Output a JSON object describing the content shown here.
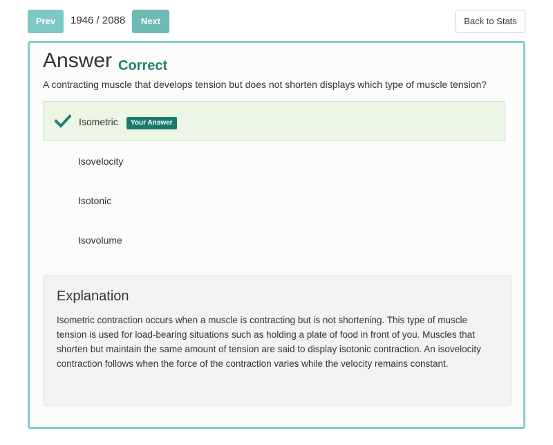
{
  "nav": {
    "prev_label": "Prev",
    "next_label": "Next",
    "counter": "1946 / 2088",
    "back_label": "Back to Stats"
  },
  "answer": {
    "heading": "Answer",
    "status": "Correct",
    "question": "A contracting muscle that develops tension but does not shorten displays which type of muscle tension?",
    "options": [
      {
        "label": "Isometric",
        "selected": true,
        "badge": "Your Answer",
        "icon": "checkmark-icon"
      },
      {
        "label": "Isovelocity",
        "selected": false
      },
      {
        "label": "Isotonic",
        "selected": false
      },
      {
        "label": "Isovolume",
        "selected": false
      }
    ]
  },
  "explanation": {
    "title": "Explanation",
    "body": "Isometric contraction occurs when a muscle is contracting but is not shortening. This type of muscle tension is used for load-bearing situations such as holding a plate of food in front of you. Muscles that shorten but maintain the same amount of tension are said to display isotonic contraction. An isovelocity contraction follows when the force of the contraction varies while the velocity remains constant."
  },
  "colors": {
    "accent": "#7cc9c4",
    "correct": "#1f8274",
    "selected_bg": "#ebf6e6",
    "badge_bg": "#1a7a6c"
  }
}
